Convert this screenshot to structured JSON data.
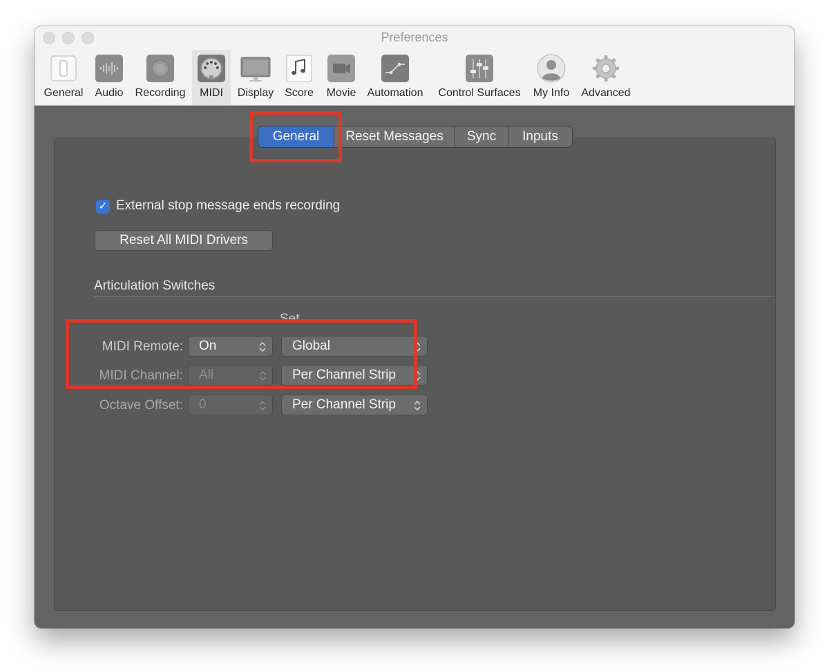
{
  "window": {
    "title": "Preferences"
  },
  "toolbar": {
    "items": [
      {
        "label": "General",
        "icon": "general-switch-icon"
      },
      {
        "label": "Audio",
        "icon": "audio-waveform-icon"
      },
      {
        "label": "Recording",
        "icon": "recording-icon"
      },
      {
        "label": "MIDI",
        "icon": "midi-connector-icon",
        "selected": true
      },
      {
        "label": "Display",
        "icon": "display-monitor-icon"
      },
      {
        "label": "Score",
        "icon": "score-note-icon"
      },
      {
        "label": "Movie",
        "icon": "movie-camera-icon"
      },
      {
        "label": "Automation",
        "icon": "automation-curve-icon"
      },
      {
        "label": "Control Surfaces",
        "icon": "control-surfaces-fader-icon"
      },
      {
        "label": "My Info",
        "icon": "user-avatar-icon"
      },
      {
        "label": "Advanced",
        "icon": "advanced-gear-icon"
      }
    ]
  },
  "tabs": [
    {
      "label": "General",
      "active": true
    },
    {
      "label": "Reset Messages"
    },
    {
      "label": "Sync"
    },
    {
      "label": "Inputs"
    }
  ],
  "general": {
    "external_stop_checkbox": {
      "label": "External stop message ends recording",
      "checked": true
    },
    "reset_button": "Reset All MIDI Drivers"
  },
  "articulation": {
    "heading": "Articulation Switches",
    "set_header": "Set",
    "rows": [
      {
        "label": "MIDI Remote:",
        "value": "On",
        "set": "Global",
        "enabled": true
      },
      {
        "label": "MIDI Channel:",
        "value": "All",
        "set": "Per Channel Strip",
        "enabled": false
      },
      {
        "label": "Octave Offset:",
        "value": "0",
        "set": "Per Channel Strip",
        "enabled": false
      }
    ]
  },
  "colors": {
    "accent": "#3a6fc4",
    "highlight": "#d93a2b",
    "panel": "#595959"
  }
}
